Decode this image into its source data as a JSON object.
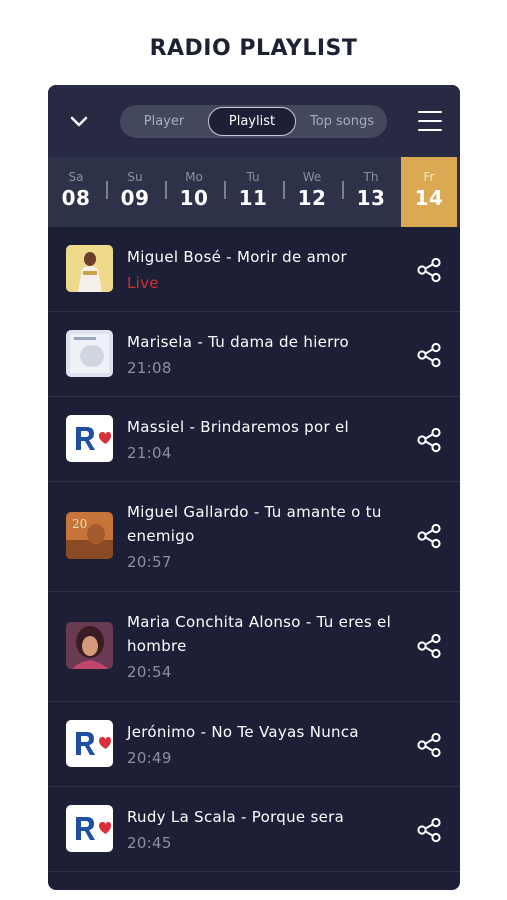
{
  "page_title": "RADIO PLAYLIST",
  "icons": {
    "collapse": "chevron-down-icon",
    "menu": "hamburger-menu-icon",
    "share": "share-icon"
  },
  "tabs": [
    {
      "label": "Player"
    },
    {
      "label": "Playlist",
      "active": true
    },
    {
      "label": "Top songs"
    }
  ],
  "days": [
    {
      "name": "Sa",
      "date": "08"
    },
    {
      "name": "Su",
      "date": "09"
    },
    {
      "name": "Mo",
      "date": "10"
    },
    {
      "name": "Tu",
      "date": "11"
    },
    {
      "name": "We",
      "date": "12"
    },
    {
      "name": "Th",
      "date": "13"
    },
    {
      "name": "Fr",
      "date": "14",
      "selected": true
    }
  ],
  "tracks": [
    {
      "title": "Miguel Bosé - Morir de amor",
      "time": "Live",
      "live": true,
      "artwork": "album-cover"
    },
    {
      "title": "Marisela - Tu dama de hierro",
      "time": "21:08",
      "artwork": "album-cover"
    },
    {
      "title": "Massiel - Brindaremos por el",
      "time": "21:04",
      "artwork": "station-logo"
    },
    {
      "title": "Miguel Gallardo - Tu amante o tu enemigo",
      "time": "20:57",
      "artwork": "album-cover"
    },
    {
      "title": "Maria Conchita Alonso - Tu eres el hombre",
      "time": "20:54",
      "artwork": "album-cover"
    },
    {
      "title": "Jerónimo - No Te Vayas Nunca",
      "time": "20:49",
      "artwork": "station-logo"
    },
    {
      "title": "Rudy La Scala - Porque sera",
      "time": "20:45",
      "artwork": "station-logo"
    }
  ],
  "colors": {
    "panel_bg": "#1d1f36",
    "topbar_bg": "#272a42",
    "day_strip_bg": "#2e3249",
    "selected_day": "#d9aa53",
    "live_text": "#d0322f",
    "secondary_text": "#8b8fa3"
  }
}
